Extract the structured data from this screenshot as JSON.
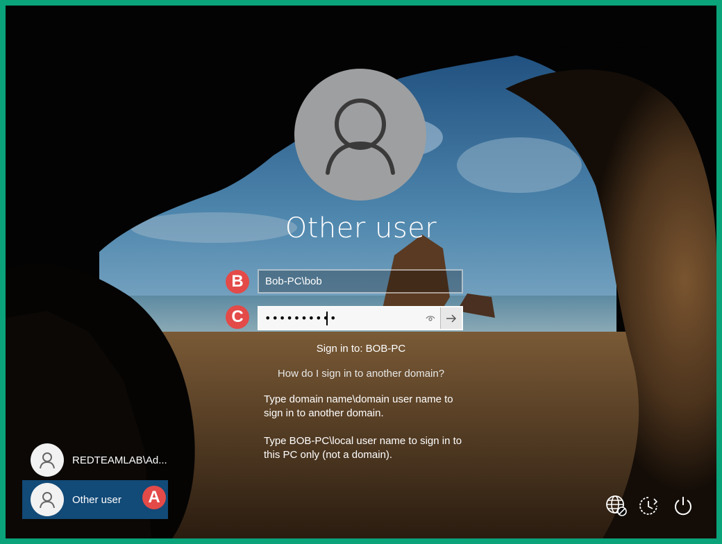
{
  "login": {
    "user_title": "Other user",
    "username_value": "Bob-PC\\bob",
    "password_mask": "••••••••••",
    "sign_in_to": "Sign in to: BOB-PC",
    "help_link": "How do I sign in to another domain?",
    "help_text_1": "Type domain name\\domain user name to sign in to another domain.",
    "help_text_2": "Type BOB-PC\\local user name to sign in to this PC only (not a domain)."
  },
  "markers": {
    "a": "A",
    "b": "B",
    "c": "C"
  },
  "user_list": [
    {
      "label": "REDTEAMLAB\\Ad...",
      "selected": false
    },
    {
      "label": "Other user",
      "selected": true
    }
  ],
  "system_buttons": [
    {
      "name": "network-icon"
    },
    {
      "name": "ease-of-access-icon"
    },
    {
      "name": "power-icon"
    }
  ],
  "colors": {
    "border_accent": "#0aa37a",
    "marker_red": "#e34a48",
    "selected_tile": "#124a78"
  }
}
